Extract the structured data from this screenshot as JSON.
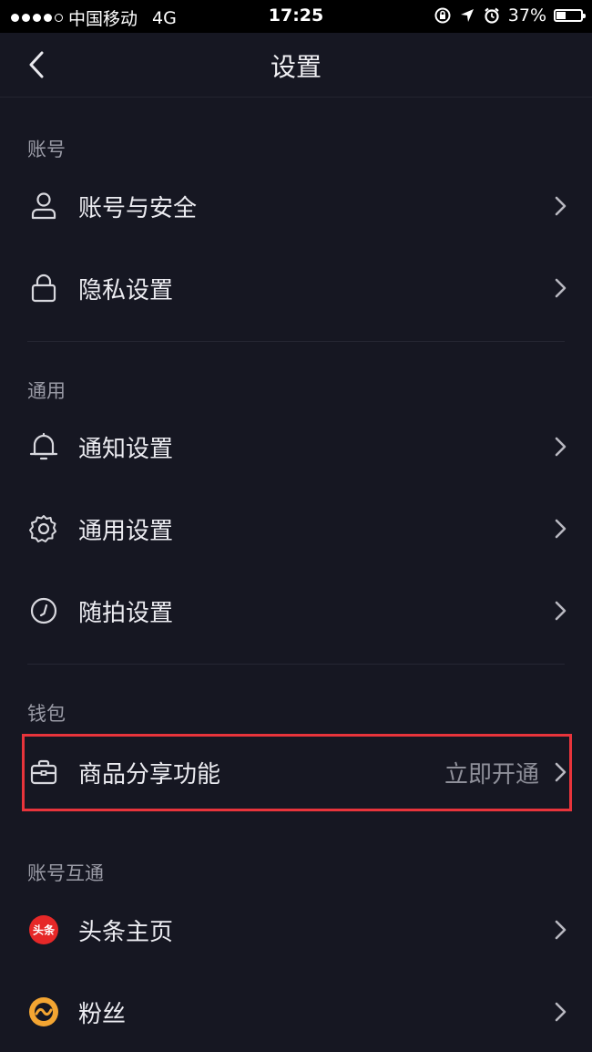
{
  "status_bar": {
    "carrier": "中国移动",
    "network": "4G",
    "time": "17:25",
    "battery": "37%",
    "battery_level": 0.37
  },
  "nav": {
    "title": "设置"
  },
  "sections": {
    "account": {
      "title": "账号",
      "items": [
        {
          "label": "账号与安全",
          "icon": "user-icon"
        },
        {
          "label": "隐私设置",
          "icon": "lock-icon"
        }
      ]
    },
    "general": {
      "title": "通用",
      "items": [
        {
          "label": "通知设置",
          "icon": "bell-icon"
        },
        {
          "label": "通用设置",
          "icon": "gear-icon"
        },
        {
          "label": "随拍设置",
          "icon": "clock-icon"
        }
      ]
    },
    "wallet": {
      "title": "钱包",
      "items": [
        {
          "label": "商品分享功能",
          "value": "立即开通",
          "icon": "briefcase-icon"
        }
      ]
    },
    "linked": {
      "title": "账号互通",
      "items": [
        {
          "label": "头条主页",
          "icon": "toutiao-logo-icon",
          "logo_text": "头条"
        },
        {
          "label": "粉丝",
          "icon": "fans-logo-icon"
        }
      ]
    }
  },
  "colors": {
    "background": "#161722",
    "highlight": "#e8343b",
    "toutiao_red": "#e62828",
    "fans_orange": "#f3a532"
  }
}
